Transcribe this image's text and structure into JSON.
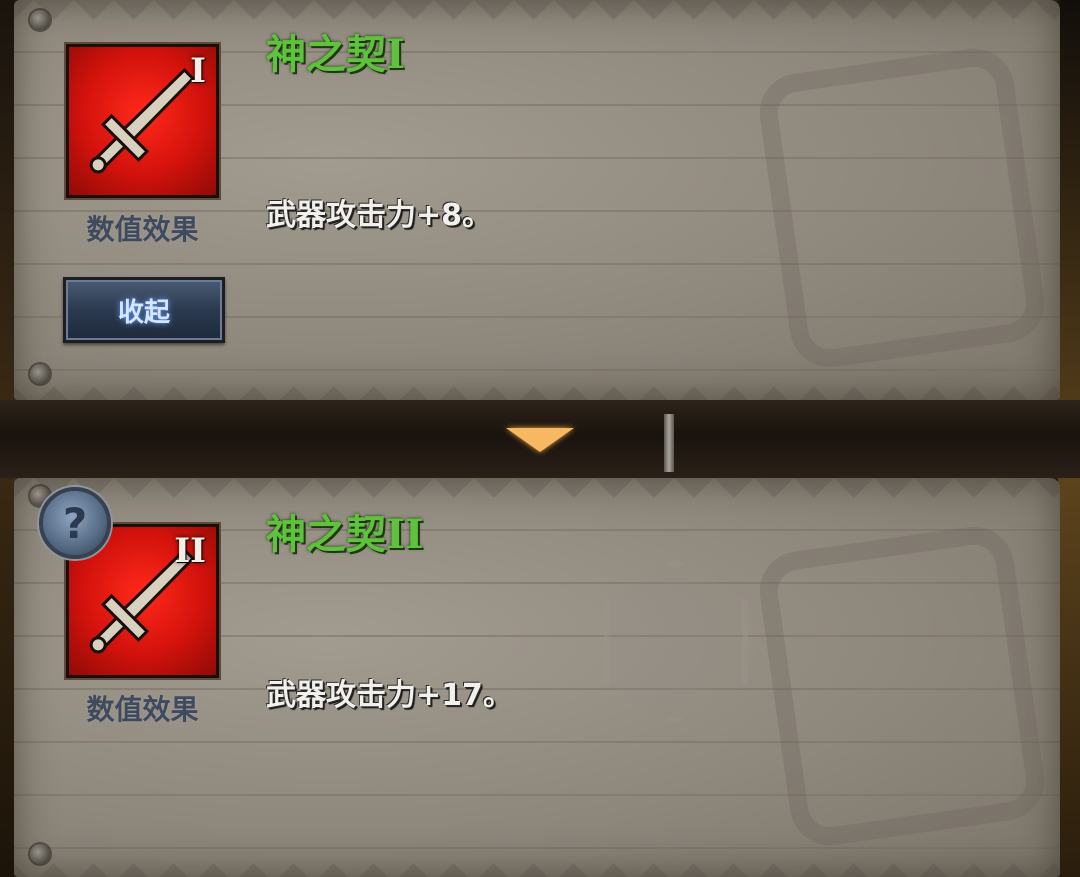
{
  "skills": [
    {
      "title": "神之契",
      "numeral": "I",
      "badge": "I",
      "effect_label": "数值效果",
      "description": "武器攻击力+8。"
    },
    {
      "title": "神之契",
      "numeral": "II",
      "badge": "II",
      "effect_label": "数值效果",
      "description": "武器攻击力+17。"
    }
  ],
  "collapse_button": {
    "label": "收起"
  },
  "help_button": {
    "label": "?"
  },
  "colors": {
    "title_green": "#5ec23c",
    "icon_red": "#e3140f",
    "expand_arrow": "#f6b860"
  },
  "icons": {
    "skill": "sword-icon",
    "expand": "triangle-down-icon",
    "help": "question-icon"
  }
}
